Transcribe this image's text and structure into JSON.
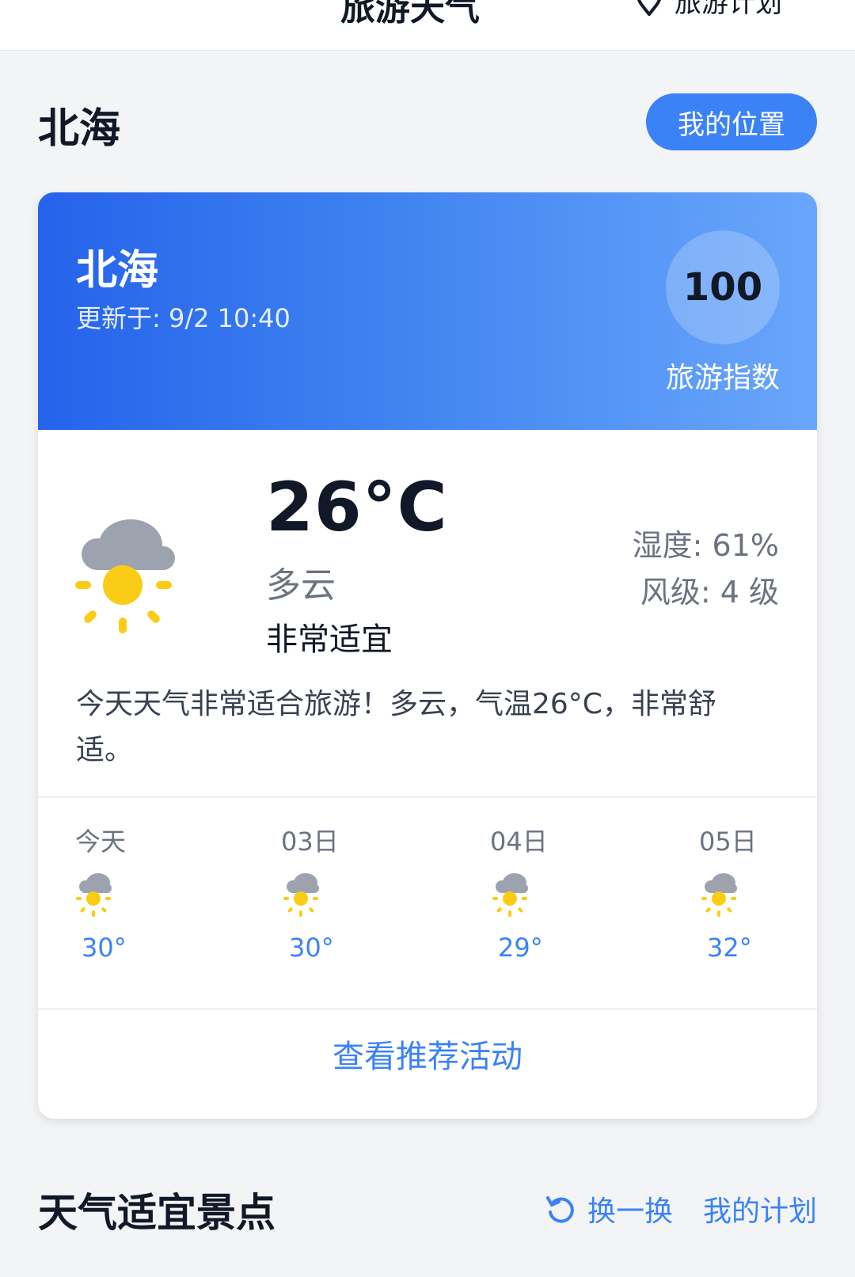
{
  "header": {
    "app_title": "旅游天气",
    "plan_link": "旅游计划"
  },
  "location": {
    "title": "北海",
    "my_location_button": "我的位置"
  },
  "weather_card": {
    "city": "北海",
    "updated": "更新于: 9/2 10:40",
    "travel_index": "100",
    "travel_index_label": "旅游指数",
    "temperature": "26°C",
    "condition": "多云",
    "comfort": "非常适宜",
    "humidity": "湿度: 61%",
    "wind": "风级: 4 级",
    "description": "今天天气非常适合旅游！多云，气温26°C，非常舒适。",
    "icon": "partly-cloudy-sun-icon",
    "forecast": [
      {
        "day": "今天",
        "temp": "30°",
        "icon": "partly-cloudy-sun-icon"
      },
      {
        "day": "03日",
        "temp": "30°",
        "icon": "partly-cloudy-sun-icon"
      },
      {
        "day": "04日",
        "temp": "29°",
        "icon": "partly-cloudy-sun-icon"
      },
      {
        "day": "05日",
        "temp": "32°",
        "icon": "partly-cloudy-sun-icon"
      }
    ],
    "activity_button": "查看推荐活动"
  },
  "attractions": {
    "title": "天气适宜景点",
    "refresh_button": "换一换",
    "my_plan_button": "我的计划"
  },
  "colors": {
    "accent": "#3b82f6",
    "gradient_start": "#2563eb",
    "gradient_end": "#69a6fb",
    "sun": "#facc15",
    "cloud": "#9ca3af"
  }
}
